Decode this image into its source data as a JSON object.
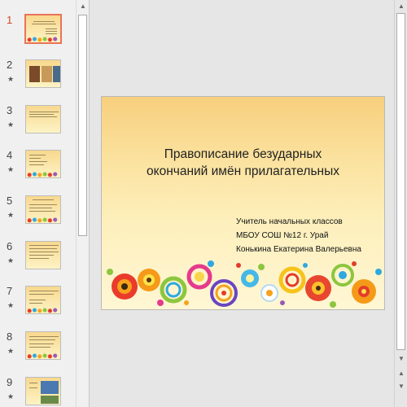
{
  "thumbnails": [
    {
      "number": "1",
      "has_animation": false,
      "selected": true
    },
    {
      "number": "2",
      "has_animation": true,
      "selected": false
    },
    {
      "number": "3",
      "has_animation": true,
      "selected": false
    },
    {
      "number": "4",
      "has_animation": true,
      "selected": false
    },
    {
      "number": "5",
      "has_animation": true,
      "selected": false
    },
    {
      "number": "6",
      "has_animation": true,
      "selected": false
    },
    {
      "number": "7",
      "has_animation": true,
      "selected": false
    },
    {
      "number": "8",
      "has_animation": true,
      "selected": false
    },
    {
      "number": "9",
      "has_animation": true,
      "selected": false
    }
  ],
  "animation_marker": "★",
  "slide": {
    "title_line1": "Правописание безударных",
    "title_line2": "окончаний имён прилагательных",
    "subtitle_line1": "Учитель начальных классов",
    "subtitle_line2": "МБОУ СОШ №12 г. Урай",
    "subtitle_line3": "Конькина Екатерина Валерьевна"
  },
  "colors": {
    "selected_thumb_border": "#e8735a",
    "selected_number": "#d24726",
    "slide_bg_top": "#f7cf7d",
    "slide_bg_bottom": "#fff6d4"
  }
}
